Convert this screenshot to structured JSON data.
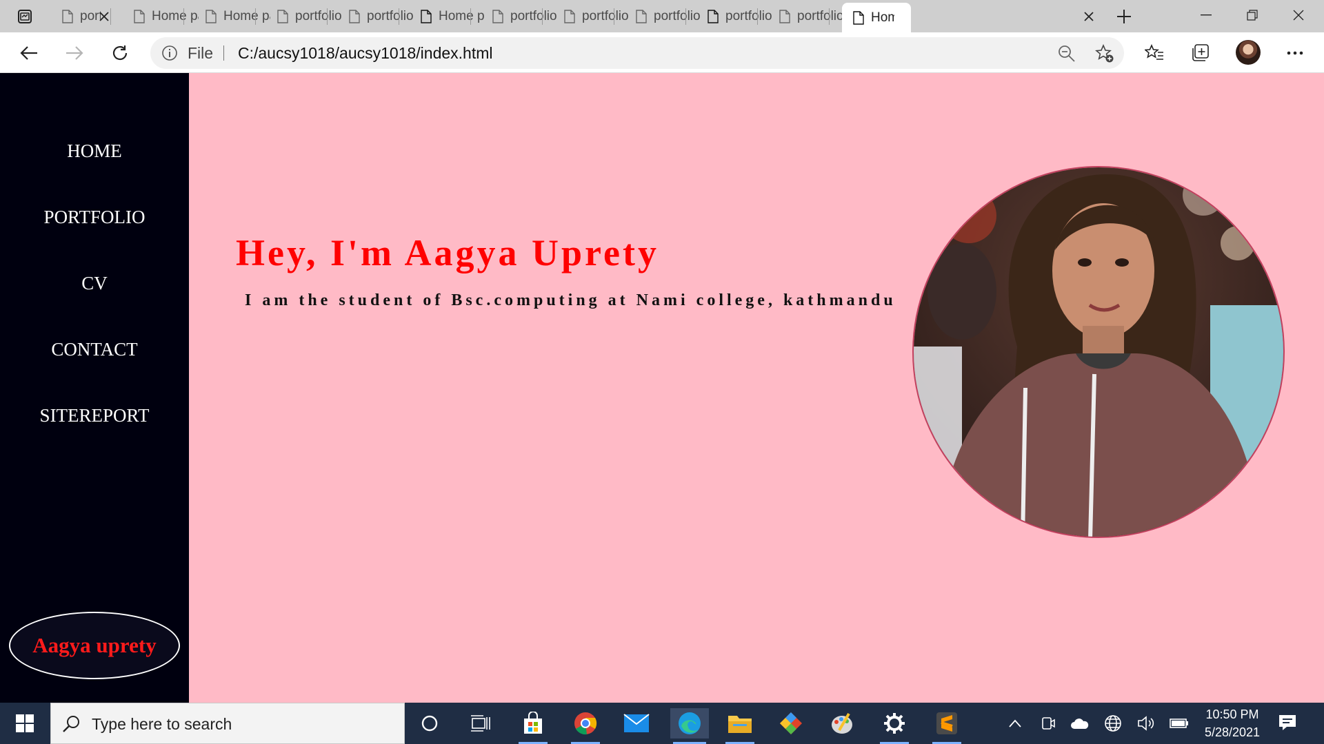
{
  "browser": {
    "tabs": [
      {
        "label": "portfolio",
        "icon": "page-icon"
      },
      {
        "label": "Home page",
        "icon": "page-icon"
      },
      {
        "label": "Home page",
        "icon": "page-icon"
      },
      {
        "label": "portfolio",
        "icon": "page-icon"
      },
      {
        "label": "portfolio",
        "icon": "page-icon"
      },
      {
        "label": "Home page",
        "icon": "page-icon"
      },
      {
        "label": "portfolio",
        "icon": "page-icon"
      },
      {
        "label": "portfolio",
        "icon": "page-icon"
      },
      {
        "label": "portfolio",
        "icon": "page-icon"
      },
      {
        "label": "portfolio",
        "icon": "page-icon"
      },
      {
        "label": "portfolio",
        "icon": "page-icon"
      },
      {
        "label": "Home page",
        "icon": "page-icon",
        "active": true
      }
    ],
    "address": {
      "scheme_label": "File",
      "url": "C:/aucsy1018/aucsy1018/index.html"
    }
  },
  "sidebar": {
    "nav": [
      "HOME",
      "PORTFOLIO",
      "CV",
      "CONTACT",
      "SITEREPORT"
    ],
    "logo_text": "Aagya uprety"
  },
  "hero": {
    "title": "Hey, I'm Aagya Uprety",
    "subtitle": "I am the student of Bsc.computing at Nami college, kathmandu"
  },
  "taskbar": {
    "search_placeholder": "Type here to search",
    "time": "10:50 PM",
    "date": "5/28/2021"
  },
  "colors": {
    "page_background": "#ffbac6",
    "sidebar_background": "#00000f",
    "title_red": "#ff0000",
    "taskbar": "#1f2d44"
  }
}
